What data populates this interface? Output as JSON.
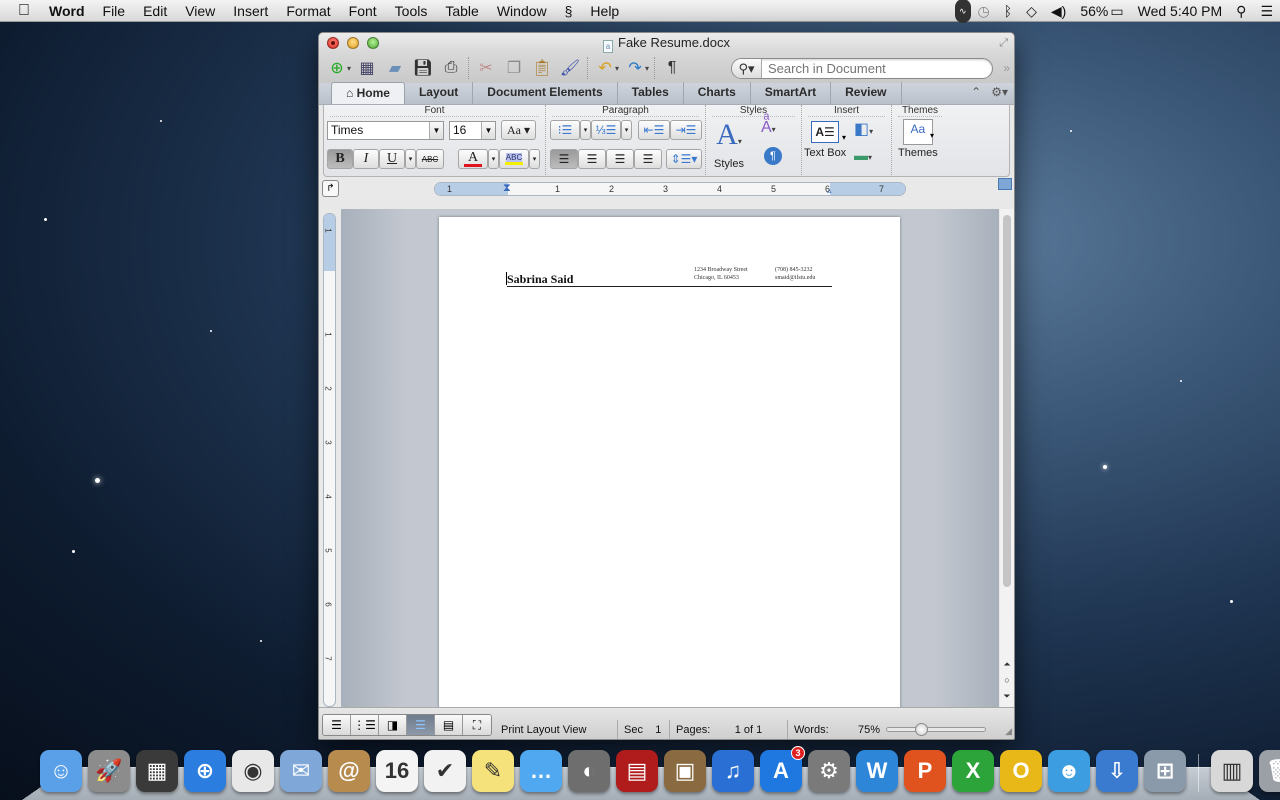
{
  "menubar": {
    "app_name": "Word",
    "items": [
      "File",
      "Edit",
      "View",
      "Insert",
      "Format",
      "Font",
      "Tools",
      "Table",
      "Window",
      "Help"
    ],
    "script_menu_icon": "script-icon",
    "status": {
      "battery_percent": "56%",
      "clock": "Wed 5:40 PM"
    },
    "icons": [
      "activity-monitor-icon",
      "time-machine-icon",
      "bluetooth-icon",
      "wifi-icon",
      "volume-icon",
      "battery-icon",
      "spotlight-icon",
      "notification-center-icon"
    ]
  },
  "window": {
    "title": "Fake Resume.docx",
    "toolbar": {
      "search_placeholder": "Search in Document",
      "buttons": [
        "new",
        "templates",
        "open",
        "save",
        "print",
        "cut",
        "copy",
        "paste",
        "format-painter",
        "undo",
        "redo",
        "show-formatting"
      ]
    },
    "ribbon_tabs": [
      "Home",
      "Layout",
      "Document Elements",
      "Tables",
      "Charts",
      "SmartArt",
      "Review"
    ],
    "active_tab": "Home",
    "ribbon": {
      "font_group_label": "Font",
      "font_name": "Times",
      "font_size": "16",
      "bold": "B",
      "italic": "I",
      "underline": "U",
      "strikethrough": "ABC",
      "font_color_glyph": "A",
      "highlight_glyph": "ABC",
      "font_color": "#e0141e",
      "highlight_color": "#f5f000",
      "paragraph_group_label": "Paragraph",
      "styles_group_label": "Styles",
      "styles_label": "Styles",
      "insert_group_label": "Insert",
      "textbox_label": "Text Box",
      "themes_group_label": "Themes",
      "themes_label": "Themes",
      "theme_glyph": "Aa"
    },
    "ruler": {
      "h_numbers": [
        "1",
        "1",
        "2",
        "3",
        "4",
        "5",
        "6",
        "7"
      ],
      "v_numbers": [
        "1",
        "1",
        "2",
        "3",
        "4",
        "5",
        "6",
        "7"
      ]
    },
    "document": {
      "name": "Sabrina Said",
      "address_line1": "1234 Broadway Street",
      "address_line2": "Chicago, IL 60453",
      "phone": "(708) 845-3232",
      "email": "smaid@ilstu.edu"
    },
    "statusbar": {
      "view_name": "Print Layout View",
      "sec_label": "Sec",
      "sec_value": "1",
      "pages_label": "Pages:",
      "pages_value": "1 of 1",
      "words_label": "Words:",
      "zoom": "75%",
      "zoom_fraction": 0.34
    }
  },
  "dock": {
    "items": [
      {
        "name": "Finder",
        "color": "#5aa0e8",
        "glyph": "☺"
      },
      {
        "name": "Launchpad",
        "color": "#8c8c8c",
        "glyph": "🚀"
      },
      {
        "name": "Mission Control",
        "color": "#3a3a3a",
        "glyph": "▦"
      },
      {
        "name": "Safari",
        "color": "#2c7de0",
        "glyph": "⊕"
      },
      {
        "name": "Google Chrome",
        "color": "#e8e8e8",
        "glyph": "◉"
      },
      {
        "name": "Mail",
        "color": "#7fa8d8",
        "glyph": "✉"
      },
      {
        "name": "Contacts",
        "color": "#b78a4e",
        "glyph": "@"
      },
      {
        "name": "Calendar",
        "color": "#f4f4f4",
        "glyph": "16"
      },
      {
        "name": "Reminders",
        "color": "#f2f2f2",
        "glyph": "✔"
      },
      {
        "name": "Notes",
        "color": "#f5e27a",
        "glyph": "✎"
      },
      {
        "name": "Messages",
        "color": "#4fa8f0",
        "glyph": "…"
      },
      {
        "name": "FaceTime",
        "color": "#6e6e6e",
        "glyph": "◐"
      },
      {
        "name": "Photo Booth",
        "color": "#b01c1c",
        "glyph": "▤"
      },
      {
        "name": "iPhoto",
        "color": "#8a6a40",
        "glyph": "▣"
      },
      {
        "name": "iTunes",
        "color": "#2a6fd4",
        "glyph": "♫"
      },
      {
        "name": "App Store",
        "color": "#1f78e0",
        "glyph": "A",
        "badge": "3"
      },
      {
        "name": "System Preferences",
        "color": "#7a7a7a",
        "glyph": "⚙"
      },
      {
        "name": "Microsoft Word",
        "color": "#2e86d8",
        "glyph": "W"
      },
      {
        "name": "Microsoft PowerPoint",
        "color": "#e0531e",
        "glyph": "P"
      },
      {
        "name": "Microsoft Excel",
        "color": "#2da43a",
        "glyph": "X"
      },
      {
        "name": "Microsoft Outlook",
        "color": "#e8b718",
        "glyph": "O"
      },
      {
        "name": "Microsoft Messenger",
        "color": "#3c9ee0",
        "glyph": "☻"
      },
      {
        "name": "Microsoft Document Connection",
        "color": "#3a7bd0",
        "glyph": "⇩"
      },
      {
        "name": "Remote Desktop Connection",
        "color": "#8a9aaa",
        "glyph": "⊞"
      }
    ],
    "right_items": [
      {
        "name": "Chrome App Launcher",
        "color": "#d8d8d8",
        "glyph": "▥"
      },
      {
        "name": "Trash",
        "color": "#9aa0a6",
        "glyph": "🗑"
      }
    ]
  }
}
